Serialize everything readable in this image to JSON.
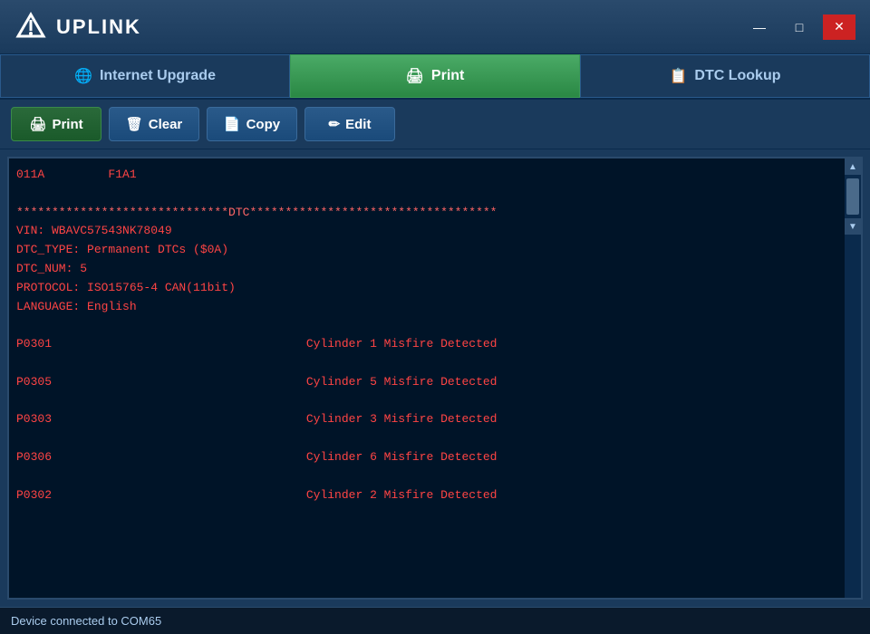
{
  "titleBar": {
    "appName": "UPLINK",
    "minimize": "—",
    "restore": "□",
    "close": "✕"
  },
  "navTabs": [
    {
      "id": "internet-upgrade",
      "label": "Internet Upgrade",
      "icon": "🌐",
      "active": false
    },
    {
      "id": "print",
      "label": "Print",
      "icon": "🖨",
      "active": true
    },
    {
      "id": "dtc-lookup",
      "label": "DTC Lookup",
      "icon": "📋",
      "active": false
    }
  ],
  "toolbar": {
    "printLabel": "Print",
    "clearLabel": "Clear",
    "copyLabel": "Copy",
    "editLabel": "Edit"
  },
  "content": {
    "lines": [
      {
        "type": "info",
        "text": "011A         F1A1"
      },
      {
        "type": "empty"
      },
      {
        "type": "header",
        "text": "******************************DTC***********************************"
      },
      {
        "type": "info",
        "text": "VIN: WBAVC57543NK78049"
      },
      {
        "type": "info",
        "text": "DTC_TYPE: Permanent DTCs ($0A)"
      },
      {
        "type": "info",
        "text": "DTC_NUM: 5"
      },
      {
        "type": "info",
        "text": "PROTOCOL: ISO15765-4 CAN(11bit)"
      },
      {
        "type": "info",
        "text": "LANGUAGE: English"
      },
      {
        "type": "empty"
      },
      {
        "type": "dtc",
        "code": "P0301",
        "desc": "Cylinder 1 Misfire Detected"
      },
      {
        "type": "empty"
      },
      {
        "type": "dtc",
        "code": "P0305",
        "desc": "Cylinder 5 Misfire Detected"
      },
      {
        "type": "empty"
      },
      {
        "type": "dtc",
        "code": "P0303",
        "desc": "Cylinder 3 Misfire Detected"
      },
      {
        "type": "empty"
      },
      {
        "type": "dtc",
        "code": "P0306",
        "desc": "Cylinder 6 Misfire Detected"
      },
      {
        "type": "empty"
      },
      {
        "type": "dtc",
        "code": "P0302",
        "desc": "Cylinder 2 Misfire Detected"
      }
    ]
  },
  "statusBar": {
    "text": "Device connected to COM65"
  }
}
